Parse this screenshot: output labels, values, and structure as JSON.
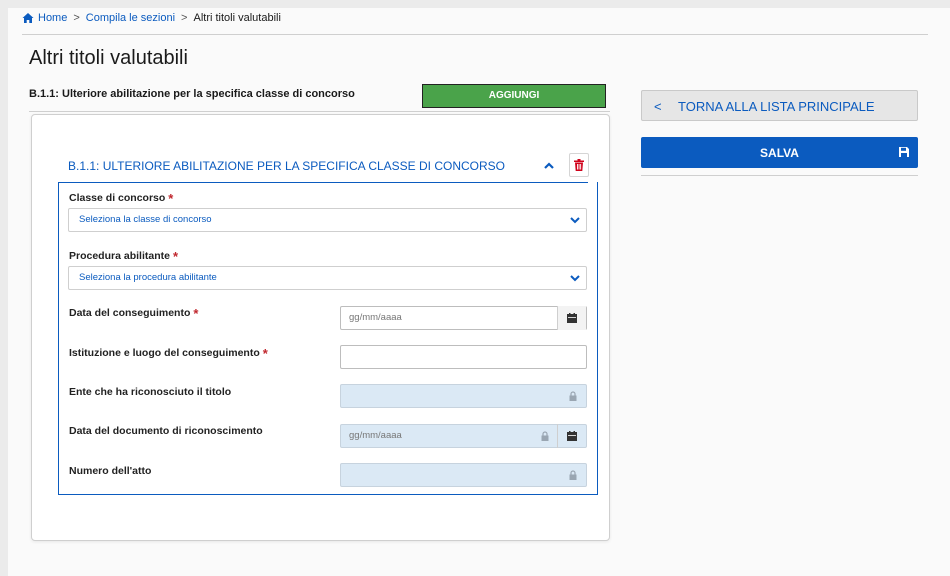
{
  "breadcrumb": {
    "home": "Home",
    "sep1": ">",
    "sections": "Compila le sezioni",
    "sep2": ">",
    "current": "Altri titoli valutabili"
  },
  "page_title": "Altri titoli valutabili",
  "section_label": "B.1.1: Ulteriore abilitazione per la specifica classe di concorso",
  "add_button": "AGGIUNGI",
  "accordion": {
    "title": "B.1.1: ULTERIORE ABILITAZIONE PER LA SPECIFICA CLASSE DI CONCORSO"
  },
  "form": {
    "classe": {
      "label": "Classe di concorso",
      "required": "*",
      "value": "Seleziona la classe di concorso"
    },
    "procedura": {
      "label": "Procedura abilitante",
      "required": "*",
      "value": "Seleziona la procedura abilitante"
    },
    "data_conseguimento": {
      "label": "Data del conseguimento",
      "required": "*",
      "placeholder": "gg/mm/aaaa"
    },
    "istituzione": {
      "label": "Istituzione e luogo del conseguimento",
      "required": "*",
      "value": ""
    },
    "ente": {
      "label": "Ente che ha riconosciuto il titolo",
      "value": ""
    },
    "data_documento": {
      "label": "Data del documento di riconoscimento",
      "placeholder": "gg/mm/aaaa"
    },
    "numero_atto": {
      "label": "Numero dell'atto",
      "value": ""
    }
  },
  "sidebar": {
    "back_button": "TORNA ALLA LISTA PRINCIPALE",
    "back_arrow": "<",
    "save_button": "SALVA"
  },
  "colors": {
    "primary": "#0b5bbf",
    "success": "#4aa34a",
    "required": "#c0262d",
    "disabled_field": "#dbe9f5"
  }
}
